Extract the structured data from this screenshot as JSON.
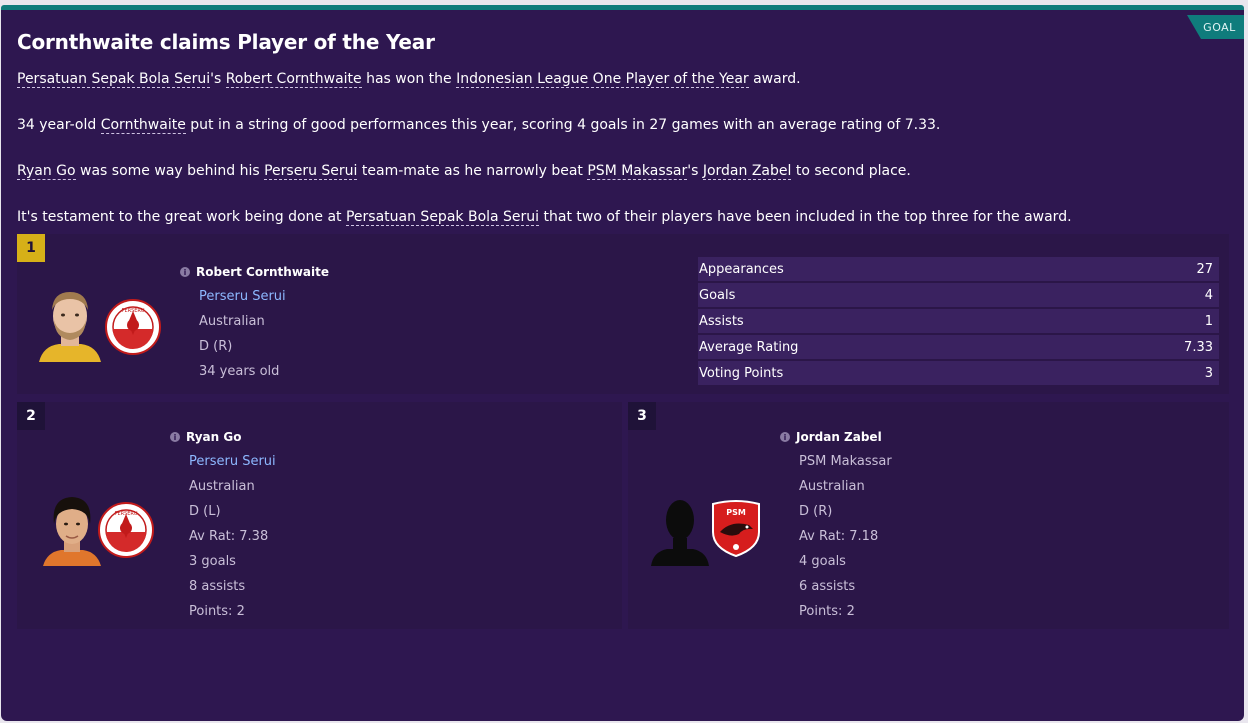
{
  "tag": "GOAL",
  "headline": "Cornthwaite claims Player of the Year",
  "paragraphs": {
    "p1": {
      "club": "Persatuan Sepak Bola Serui",
      "s1": "'s ",
      "player": "Robert Cornthwaite",
      "s2": " has won the ",
      "award": "Indonesian League One Player of the Year",
      "s3": " award."
    },
    "p2": {
      "s1": "34 year-old ",
      "player": "Cornthwaite",
      "s2": " put in a string of good performances this year, scoring 4 goals in 27 games with an average rating of 7.33."
    },
    "p3": {
      "player": "Ryan Go",
      "s1": " was some way behind his ",
      "club": "Perseru Serui",
      "s2": " team-mate as he narrowly beat ",
      "club2": "PSM Makassar",
      "s3": "'s ",
      "player2": "Jordan Zabel",
      "s4": " to second place."
    },
    "p4": {
      "s1": "It's testament to the great work being done at ",
      "club": "Persatuan Sepak Bola Serui",
      "s2": " that two of their players have been included in the top three for the award."
    }
  },
  "first": {
    "rank": "1",
    "name": "Robert Cornthwaite",
    "club": "Perseru Serui",
    "nationality": "Australian",
    "position": "D (R)",
    "age": "34 years old",
    "club_badge_text": "PERSERU",
    "stats": [
      {
        "label": "Appearances",
        "value": "27"
      },
      {
        "label": "Goals",
        "value": "4"
      },
      {
        "label": "Assists",
        "value": "1"
      },
      {
        "label": "Average Rating",
        "value": "7.33"
      },
      {
        "label": "Voting Points",
        "value": "3"
      }
    ]
  },
  "second": {
    "rank": "2",
    "name": "Ryan Go",
    "club": "Perseru Serui",
    "nationality": "Australian",
    "position": "D (L)",
    "rating": "Av Rat: 7.38",
    "goals": "3 goals",
    "assists": "8 assists",
    "points": "Points: 2",
    "club_badge_text": "PERSERU"
  },
  "third": {
    "rank": "3",
    "name": "Jordan Zabel",
    "club": "PSM Makassar",
    "nationality": "Australian",
    "position": "D (R)",
    "rating": "Av Rat: 7.18",
    "goals": "4 goals",
    "assists": "6 assists",
    "points": "Points: 2",
    "club_badge_text": "PSM"
  },
  "colors": {
    "background": "#2e1750",
    "accent": "#0f7c7c",
    "gold": "#d6b018",
    "link": "#8db8ff"
  }
}
